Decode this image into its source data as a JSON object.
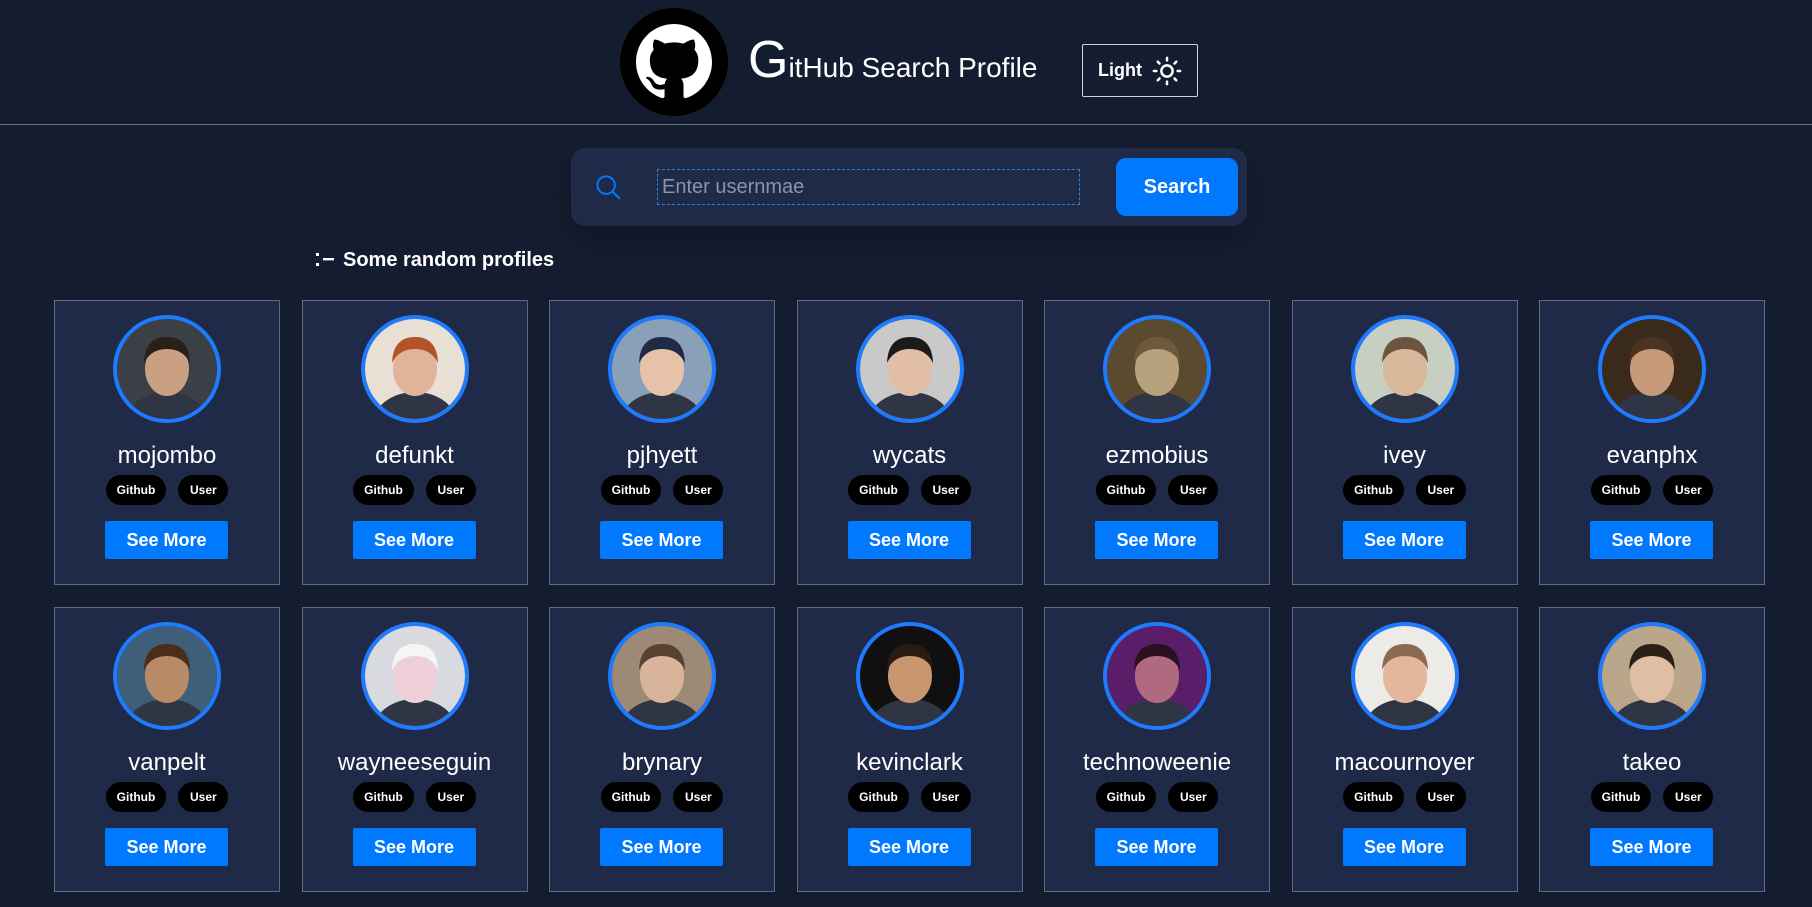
{
  "header": {
    "title_initial": "G",
    "title_rest": "itHub Search Profile",
    "theme_label": "Light",
    "logo_icon": "github-octocat-icon",
    "theme_icon": "sun-icon"
  },
  "search": {
    "placeholder": "Enter usernmae",
    "value": "",
    "button_label": "Search",
    "icon": "search-icon"
  },
  "section": {
    "heading": "Some random profiles",
    "icon": "list-icon"
  },
  "colors": {
    "background": "#141d2f",
    "card": "#1e2a47",
    "accent": "#0079ff",
    "tag": "#000000"
  },
  "profiles": [
    {
      "username": "mojombo",
      "tag1": "Github",
      "tag2": "User",
      "button": "See More",
      "skin": "#c9a084",
      "hair": "#2b2018",
      "bg": "#3b3f46"
    },
    {
      "username": "defunkt",
      "tag1": "Github",
      "tag2": "User",
      "button": "See More",
      "skin": "#e0b49b",
      "hair": "#b4532a",
      "bg": "#e8e0d5"
    },
    {
      "username": "pjhyett",
      "tag1": "Github",
      "tag2": "User",
      "button": "See More",
      "skin": "#e6c2a8",
      "hair": "#1f2a44",
      "bg": "#8aa0b8"
    },
    {
      "username": "wycats",
      "tag1": "Github",
      "tag2": "User",
      "button": "See More",
      "skin": "#e3bea6",
      "hair": "#1b1b1b",
      "bg": "#c9c9c9"
    },
    {
      "username": "ezmobius",
      "tag1": "Github",
      "tag2": "User",
      "button": "See More",
      "skin": "#b8a27d",
      "hair": "#6e5a3a",
      "bg": "#5a4a30"
    },
    {
      "username": "ivey",
      "tag1": "Github",
      "tag2": "User",
      "button": "See More",
      "skin": "#d9b79b",
      "hair": "#6b5440",
      "bg": "#c7cfc2"
    },
    {
      "username": "evanphx",
      "tag1": "Github",
      "tag2": "User",
      "button": "See More",
      "skin": "#c79b7a",
      "hair": "#4b3322",
      "bg": "#3a2a1c"
    },
    {
      "username": "vanpelt",
      "tag1": "Github",
      "tag2": "User",
      "button": "See More",
      "skin": "#b98a66",
      "hair": "#4a2e1a",
      "bg": "#3f5e7a"
    },
    {
      "username": "wayneeseguin",
      "tag1": "Github",
      "tag2": "User",
      "button": "See More",
      "skin": "#f0d0d8",
      "hair": "#f5f5f5",
      "bg": "#d9d9e0"
    },
    {
      "username": "brynary",
      "tag1": "Github",
      "tag2": "User",
      "button": "See More",
      "skin": "#d8b59a",
      "hair": "#5a4030",
      "bg": "#9c8a76"
    },
    {
      "username": "kevinclark",
      "tag1": "Github",
      "tag2": "User",
      "button": "See More",
      "skin": "#c8966f",
      "hair": "#2a1a10",
      "bg": "#101010"
    },
    {
      "username": "technoweenie",
      "tag1": "Github",
      "tag2": "User",
      "button": "See More",
      "skin": "#b06a80",
      "hair": "#2a1020",
      "bg": "#5a1d6a"
    },
    {
      "username": "macournoyer",
      "tag1": "Github",
      "tag2": "User",
      "button": "See More",
      "skin": "#e2b79b",
      "hair": "#8a6a50",
      "bg": "#ecebe7"
    },
    {
      "username": "takeo",
      "tag1": "Github",
      "tag2": "User",
      "button": "See More",
      "skin": "#e0bea4",
      "hair": "#2a2018",
      "bg": "#b9a68b"
    }
  ]
}
